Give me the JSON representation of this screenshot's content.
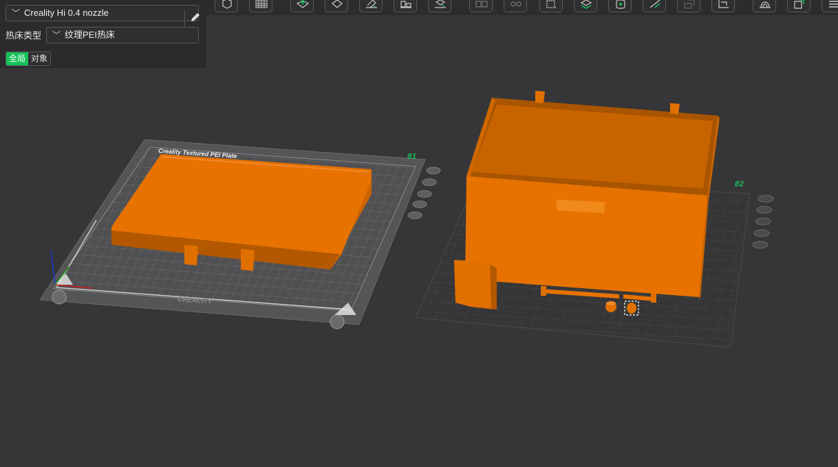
{
  "panel": {
    "printer": "Creality Hi 0.4 nozzle",
    "bed_type_label": "热床类型",
    "bed_type_value": "纹理PEI热床",
    "scope_tabs": [
      "全局",
      "对象"
    ]
  },
  "plates": {
    "plate1_number": "01",
    "plate2_number": "02",
    "plate1_label": "Creality Textured PEI Plate",
    "plate1_logo": "CREALITY"
  },
  "toolbar": {
    "icons": [
      "view-cube-icon",
      "grid-icon",
      "add-plate-icon",
      "orient-icon",
      "auto-arrange-icon",
      "layout-icon",
      "lay-on-face-icon",
      "split-objects-icon",
      "split-parts-icon",
      "measure-icon",
      "cut-icon",
      "support-paint-icon",
      "seam-paint-icon",
      "scale-icon",
      "variable-height-icon",
      "brim-ears-icon",
      "assembly-icon",
      "text-emboss-icon",
      "more-icon"
    ]
  },
  "colors": {
    "model": "#e77200",
    "model_dark": "#b35800",
    "accent": "#17c15a",
    "plate": "#555558"
  }
}
